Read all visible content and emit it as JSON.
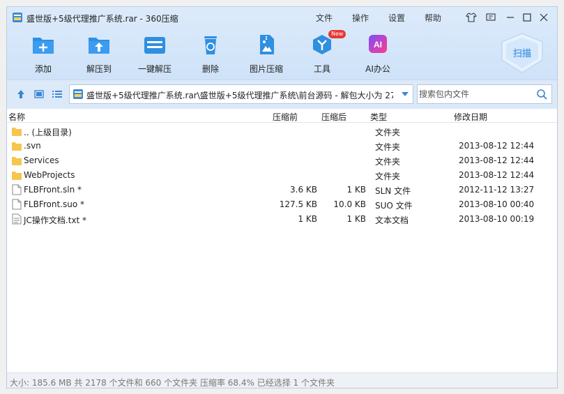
{
  "window": {
    "title": "盛世版+5级代理推广系统.rar - 360压缩",
    "menu": [
      "文件",
      "操作",
      "设置",
      "帮助"
    ]
  },
  "toolbar": {
    "items": [
      {
        "label": "添加",
        "icon": "add-icon"
      },
      {
        "label": "解压到",
        "icon": "extract-to-icon"
      },
      {
        "label": "一键解压",
        "icon": "one-click-extract-icon"
      },
      {
        "label": "删除",
        "icon": "delete-icon"
      },
      {
        "label": "图片压缩",
        "icon": "image-compress-icon"
      },
      {
        "label": "工具",
        "icon": "tools-icon",
        "badge": "New"
      },
      {
        "label": "AI办公",
        "icon": "ai-office-icon",
        "icon_text": "AI"
      }
    ],
    "scan_label": "扫描"
  },
  "nav": {
    "address": "盛世版+5级代理推广系统.rar\\盛世版+5级代理推广系统\\前台源码 - 解包大小为 27",
    "search_placeholder": "搜索包内文件"
  },
  "columns": [
    "名称",
    "压缩前",
    "压缩后",
    "类型",
    "修改日期"
  ],
  "files": [
    {
      "name": ".. (上级目录)",
      "size": "",
      "packed": "",
      "type": "文件夹",
      "date": "",
      "kind": "folder"
    },
    {
      "name": ".svn",
      "size": "",
      "packed": "",
      "type": "文件夹",
      "date": "2013-08-12 12:44",
      "kind": "folder"
    },
    {
      "name": "Services",
      "size": "",
      "packed": "",
      "type": "文件夹",
      "date": "2013-08-12 12:44",
      "kind": "folder"
    },
    {
      "name": "WebProjects",
      "size": "",
      "packed": "",
      "type": "文件夹",
      "date": "2013-08-12 12:44",
      "kind": "folder"
    },
    {
      "name": "FLBFront.sln *",
      "size": "3.6 KB",
      "packed": "1 KB",
      "type": "SLN 文件",
      "date": "2012-11-12 13:27",
      "kind": "file"
    },
    {
      "name": "FLBFront.suo *",
      "size": "127.5 KB",
      "packed": "10.0 KB",
      "type": "SUO 文件",
      "date": "2013-08-10 00:40",
      "kind": "file"
    },
    {
      "name": "JC操作文档.txt *",
      "size": "1 KB",
      "packed": "1 KB",
      "type": "文本文档",
      "date": "2013-08-10 00:19",
      "kind": "text"
    }
  ],
  "status": "大小: 185.6 MB 共 2178 个文件和 660 个文件夹 压缩率 68.4% 已经选择 1 个文件夹",
  "colors": {
    "accent": "#2f8fe0",
    "header_bg": "#d6e7fa",
    "folder": "#f5c54e"
  }
}
